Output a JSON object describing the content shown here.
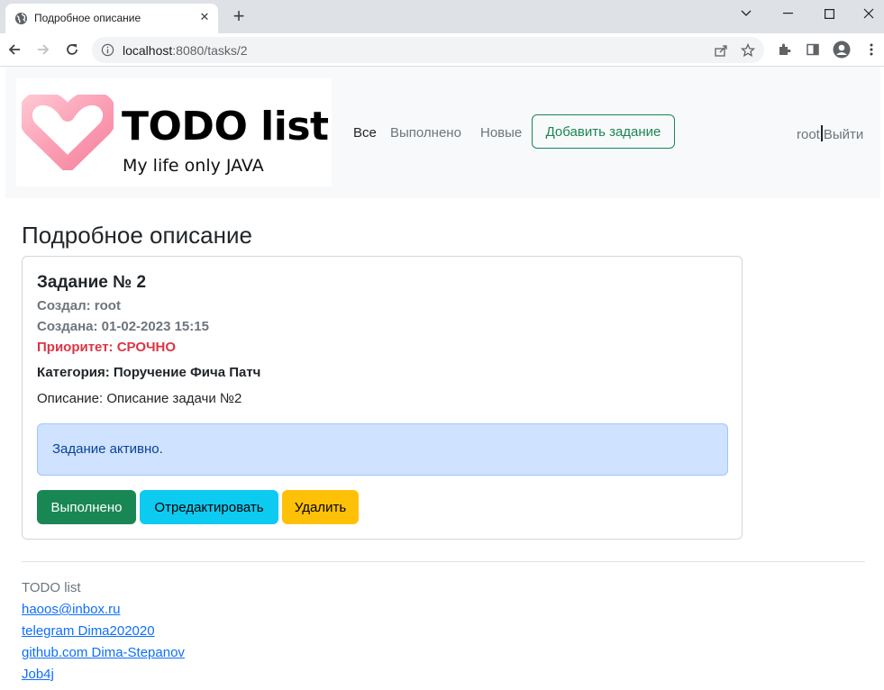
{
  "browser": {
    "tab_title": "Подробное описание",
    "url_host": "localhost",
    "url_path": ":8080/tasks/2"
  },
  "navbar": {
    "logo_title": "TODO list",
    "logo_subtitle": "My life only JAVA",
    "links": [
      "Все",
      "Выполнено",
      "Новые"
    ],
    "add_button": "Добавить задание",
    "user": "root",
    "logout": "Выйти"
  },
  "main": {
    "heading": "Подробное описание",
    "task": {
      "title": "Задание № 2",
      "creator": "Создал: root",
      "created": "Создана: 01-02-2023 15:15",
      "priority": "Приоритет: СРОЧНО",
      "category": "Категория: Поручение Фича Патч",
      "description": "Описание: Описание задачи №2",
      "status": "Задание активно."
    },
    "buttons": {
      "done": "Выполнено",
      "edit": "Отредактировать",
      "delete": "Удалить"
    }
  },
  "footer": {
    "title": "TODO list",
    "links": [
      "haoos@inbox.ru",
      "telegram Dima202020",
      "github.com Dima-Stepanov",
      "Job4j"
    ]
  },
  "colors": {
    "success": "#198754",
    "info": "#0dcaf0",
    "warning": "#ffc107",
    "danger": "#dc3545",
    "alert_bg": "#cfe2ff",
    "link": "#0d6efd"
  }
}
